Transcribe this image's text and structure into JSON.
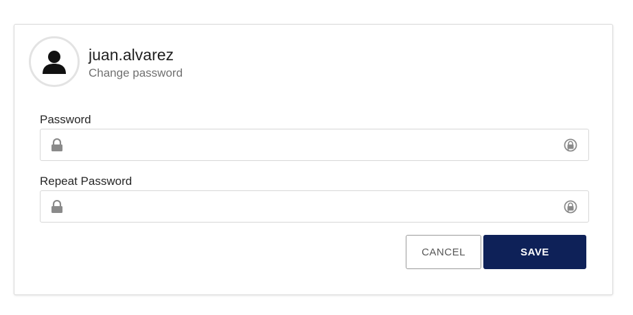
{
  "user": {
    "username": "juan.alvarez",
    "subtitle": "Change password",
    "avatar_icon": "user-icon"
  },
  "form": {
    "password_label": "Password",
    "repeat_password_label": "Repeat Password",
    "password_value": "",
    "repeat_password_value": "",
    "field_icon": "lock-icon",
    "reveal_icon": "reveal-password-icon"
  },
  "actions": {
    "cancel_label": "CANCEL",
    "save_label": "SAVE"
  },
  "colors": {
    "save_button_bg": "#0e2158",
    "icon_gray": "#8a8a8a",
    "border": "#d6d6d6"
  }
}
